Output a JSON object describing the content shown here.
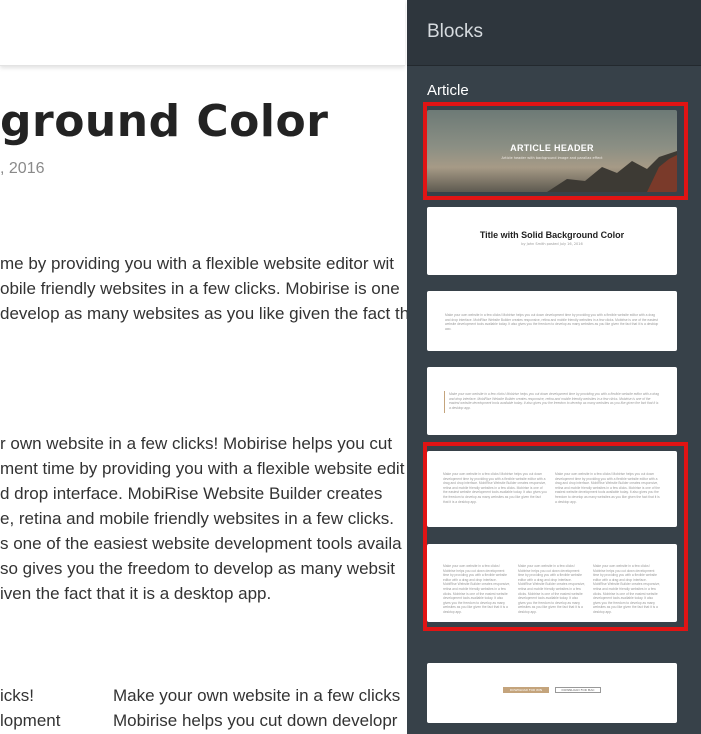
{
  "canvas": {
    "title": "ground Color",
    "date": ", 2016",
    "paragraph1": [
      "me by providing you with a flexible website editor wit",
      "obile friendly websites in a few clicks. Mobirise is one",
      "develop as many websites as you like given the fact th"
    ],
    "paragraph2": [
      "r own website in a few clicks! Mobirise helps you cut",
      "ment time by providing you with a flexible website edit",
      "d drop interface. MobiRise Website Builder creates",
      "e, retina and mobile friendly websites in a few clicks.",
      "s one of the easiest website development tools availa",
      "so gives you the freedom to develop as many websit",
      "iven the fact that it is a desktop app."
    ],
    "columns": {
      "left": [
        "icks!",
        "lopment"
      ],
      "right": [
        "Make your own website in a few clicks",
        "Mobirise helps you cut down developr"
      ]
    }
  },
  "panel": {
    "title": "Blocks",
    "section": "Article",
    "thumbs": {
      "hero_title": "ARTICLE HEADER",
      "hero_sub": "Article header with background image and parallax effect",
      "solid_title": "Title with Solid Background Color",
      "solid_sub": "by John Smith posted July 16, 2016",
      "lorem": "Make your own website in a few clicks! Mobirise helps you cut down development time by providing you with a flexible website editor with a drag and drop interface. MobiRise Website Builder creates responsive, retina and mobile friendly websites in a few clicks. Mobirise is one of the easiest website development tools available today. It also gives you the freedom to develop as many websites as you like given the fact that it is a desktop app.",
      "btn_primary": "DOWNLOAD FOR WIN",
      "btn_secondary": "DOWNLOAD FOR MAC"
    }
  },
  "colors": {
    "panel_bg": "#374149",
    "panel_header": "#2e363d",
    "highlight": "#e11414",
    "accent": "#c4a47c"
  }
}
